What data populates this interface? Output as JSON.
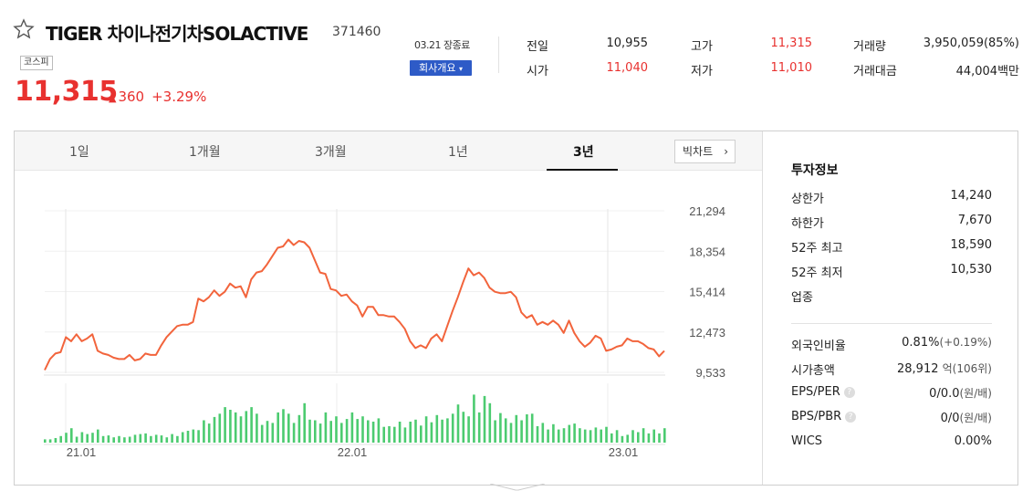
{
  "header": {
    "name": "TIGER 차이나전기차SOLACTIVE",
    "code": "371460",
    "market_badge": "코스피",
    "price": "11,315",
    "change_arrow": "▲",
    "change": "360",
    "change_pct": "+3.29%",
    "session_date": "03.21 장종료",
    "company_button": "회사개요",
    "company_button_caret": "▾"
  },
  "quote": {
    "prev_close_label": "전일",
    "prev_close": "10,955",
    "open_label": "시가",
    "open": "11,040",
    "high_label": "고가",
    "high": "11,315",
    "low_label": "저가",
    "low": "11,010",
    "volume_label": "거래량",
    "volume": "3,950,059(85%)",
    "turnover_label": "거래대금",
    "turnover": "44,004백만"
  },
  "tabs": {
    "items": [
      "1일",
      "1개월",
      "3개월",
      "1년",
      "3년"
    ],
    "active": "3년",
    "big_chart_label": "빅차트",
    "big_chart_chevron": "›"
  },
  "chart_data": {
    "type": "line",
    "x_ticks": [
      "21.01",
      "22.01",
      "23.01"
    ],
    "y_ticks": [
      "21,294",
      "18,354",
      "15,414",
      "12,473",
      "9,533"
    ],
    "ylim": [
      9533,
      21294
    ],
    "price_color": "#f2643c",
    "volume_color": "#4ccb70",
    "grid": true,
    "price": [
      9900,
      10700,
      11100,
      11200,
      12300,
      12000,
      12500,
      12000,
      12200,
      12500,
      11300,
      11100,
      11000,
      10800,
      10700,
      10700,
      11000,
      10600,
      10700,
      11100,
      11000,
      11000,
      11700,
      12300,
      12700,
      13100,
      13200,
      13200,
      13400,
      15100,
      14900,
      15200,
      15700,
      15300,
      15600,
      16200,
      15900,
      16000,
      15200,
      16500,
      17000,
      17100,
      17600,
      18200,
      18800,
      18900,
      19400,
      19000,
      19300,
      19200,
      18800,
      17900,
      17000,
      16900,
      15800,
      15700,
      15300,
      15400,
      14900,
      14600,
      13800,
      14500,
      14500,
      13900,
      13900,
      13800,
      13800,
      13400,
      12900,
      12000,
      11500,
      11700,
      11500,
      12200,
      12500,
      12000,
      13100,
      14200,
      15200,
      16300,
      17300,
      16800,
      17000,
      16600,
      15900,
      15600,
      15500,
      15500,
      15600,
      15200,
      14100,
      13700,
      13900,
      13200,
      13400,
      13200,
      13500,
      13200,
      12600,
      13500,
      12600,
      12000,
      11600,
      11900,
      12400,
      12200,
      11300,
      11400,
      11600,
      11700,
      12200,
      12000,
      12000,
      11800,
      11500,
      11400,
      10900,
      11300
    ],
    "volume": [
      0.05,
      0.05,
      0.07,
      0.1,
      0.15,
      0.22,
      0.09,
      0.16,
      0.13,
      0.15,
      0.2,
      0.1,
      0.11,
      0.08,
      0.1,
      0.08,
      0.09,
      0.12,
      0.13,
      0.14,
      0.1,
      0.12,
      0.11,
      0.08,
      0.13,
      0.1,
      0.16,
      0.18,
      0.2,
      0.19,
      0.34,
      0.29,
      0.39,
      0.44,
      0.54,
      0.5,
      0.46,
      0.4,
      0.48,
      0.54,
      0.44,
      0.27,
      0.33,
      0.3,
      0.46,
      0.51,
      0.44,
      0.3,
      0.42,
      0.6,
      0.35,
      0.34,
      0.29,
      0.46,
      0.33,
      0.4,
      0.3,
      0.36,
      0.46,
      0.36,
      0.4,
      0.34,
      0.32,
      0.37,
      0.24,
      0.25,
      0.24,
      0.32,
      0.23,
      0.32,
      0.35,
      0.26,
      0.4,
      0.31,
      0.42,
      0.35,
      0.37,
      0.44,
      0.58,
      0.47,
      0.4,
      0.73,
      0.46,
      0.71,
      0.6,
      0.34,
      0.45,
      0.37,
      0.3,
      0.42,
      0.34,
      0.43,
      0.44,
      0.25,
      0.3,
      0.2,
      0.28,
      0.2,
      0.22,
      0.27,
      0.29,
      0.22,
      0.2,
      0.19,
      0.23,
      0.2,
      0.24,
      0.14,
      0.19,
      0.1,
      0.12,
      0.19,
      0.16,
      0.22,
      0.14,
      0.2,
      0.14,
      0.22
    ]
  },
  "investment_info": {
    "title": "투자정보",
    "upper_limit_label": "상한가",
    "upper_limit": "14,240",
    "lower_limit_label": "하한가",
    "lower_limit": "7,670",
    "high52_label": "52주 최고",
    "high52": "18,590",
    "low52_label": "52주 최저",
    "low52": "10,530",
    "industry_label": "업종",
    "foreign_label": "외국인비율",
    "foreign": "0.81%",
    "foreign_chg": "(+0.19%)",
    "mcap_label": "시가총액",
    "mcap": "28,912",
    "mcap_unit": "억(106위)",
    "eps_label": "EPS/PER",
    "eps": "0/0.0",
    "eps_unit": "(원/배)",
    "bps_label": "BPS/PBR",
    "bps": "0/0",
    "bps_unit": "(원/배)",
    "wics_label": "WICS",
    "wics": "0.00%",
    "help_glyph": "?"
  }
}
